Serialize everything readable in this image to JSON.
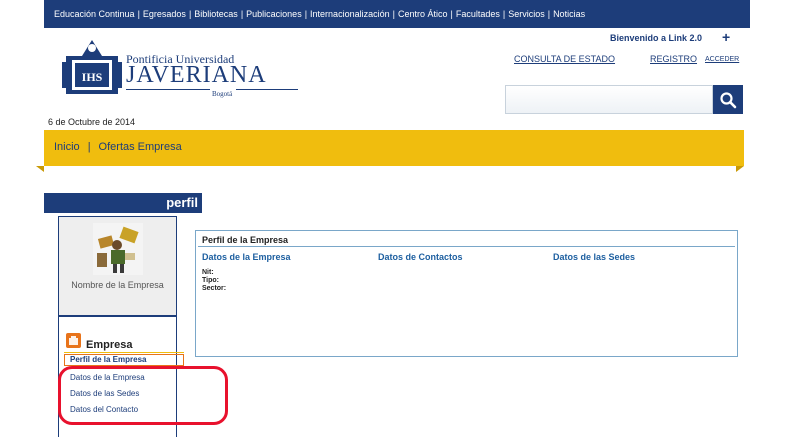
{
  "top_nav": {
    "items": [
      "Educación Continua",
      "Egresados",
      "Bibliotecas",
      "Publicaciones",
      "Internacionalización",
      "Centro Ático",
      "Facultades",
      "Servicios",
      "Noticias"
    ]
  },
  "logo": {
    "line1": "Pontificia Universidad",
    "line2": "JAVERIANA",
    "line3": "Bogotá"
  },
  "header": {
    "welcome": "Bienvenido a Link 2.0",
    "plus": "+",
    "consulta": "CONSULTA DE ESTADO",
    "registro": "REGISTRO",
    "acceder": "ACCEDER",
    "search_placeholder": ""
  },
  "date": "6 de Octubre de 2014",
  "breadcrumb": {
    "home": "Inicio",
    "separator": "|",
    "current": "Ofertas Empresa"
  },
  "sidebar": {
    "tab_label": "perfil",
    "profile_name": "Nombre de la Empresa",
    "section_title": "Empresa",
    "items": [
      {
        "label": "Perfil de la Empresa",
        "active": true
      },
      {
        "label": "Datos de la Empresa",
        "active": false
      },
      {
        "label": "Datos de las Sedes",
        "active": false
      },
      {
        "label": "Datos del Contacto",
        "active": false
      }
    ]
  },
  "main": {
    "title": "Perfil de la Empresa",
    "tabs": [
      "Datos de la Empresa",
      "Datos de Contactos",
      "Datos de las Sedes"
    ],
    "fields": [
      "Nit:",
      "Tipo:",
      "Sector:"
    ]
  },
  "colors": {
    "navy": "#1d3d7a",
    "yellow": "#f0bd0e",
    "orange": "#e8731a",
    "highlight_red": "#e8112d",
    "link_blue": "#1d5fa0"
  },
  "icons": [
    "crest-logo",
    "search-icon",
    "plus-icon",
    "company-icon",
    "profile-image"
  ]
}
